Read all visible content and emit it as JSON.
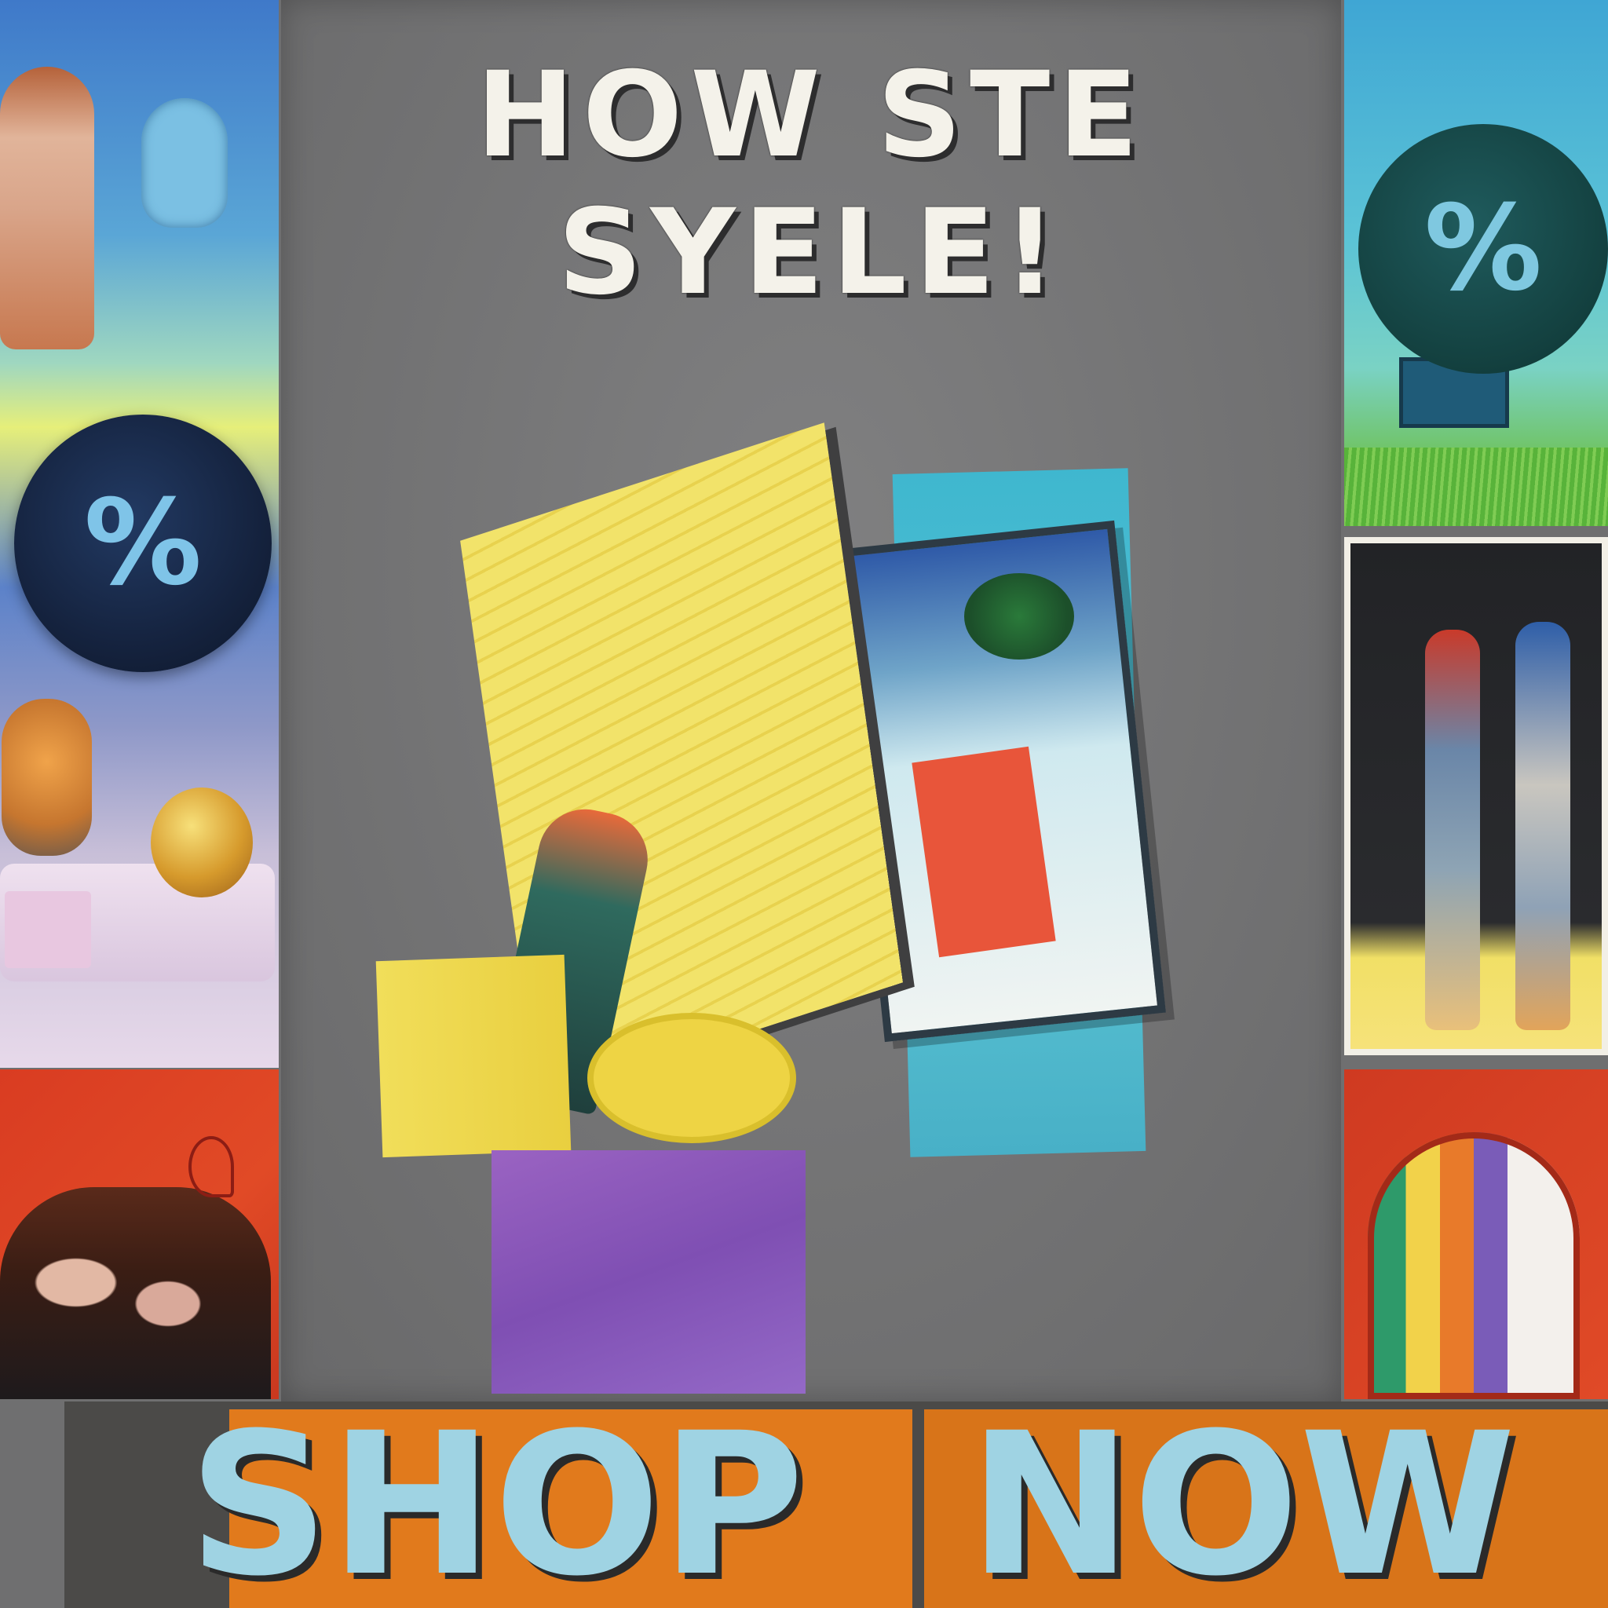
{
  "poster": {
    "headline_line1": "HOW STE",
    "headline_line2": "SYELE!",
    "subtitle": "",
    "cta": {
      "word1": "SHOP",
      "word2": "NOW"
    }
  },
  "badges": {
    "left_percent": "%",
    "right_percent": "%"
  },
  "colors": {
    "poster_gray": "#737374",
    "banner_orange": "#e17a1c",
    "banner_text": "#9fd3e3",
    "accent_red": "#d93c22",
    "accent_yellow": "#f2e36a",
    "accent_cyan": "#3fb6cf",
    "accent_purple": "#8e5db8"
  }
}
